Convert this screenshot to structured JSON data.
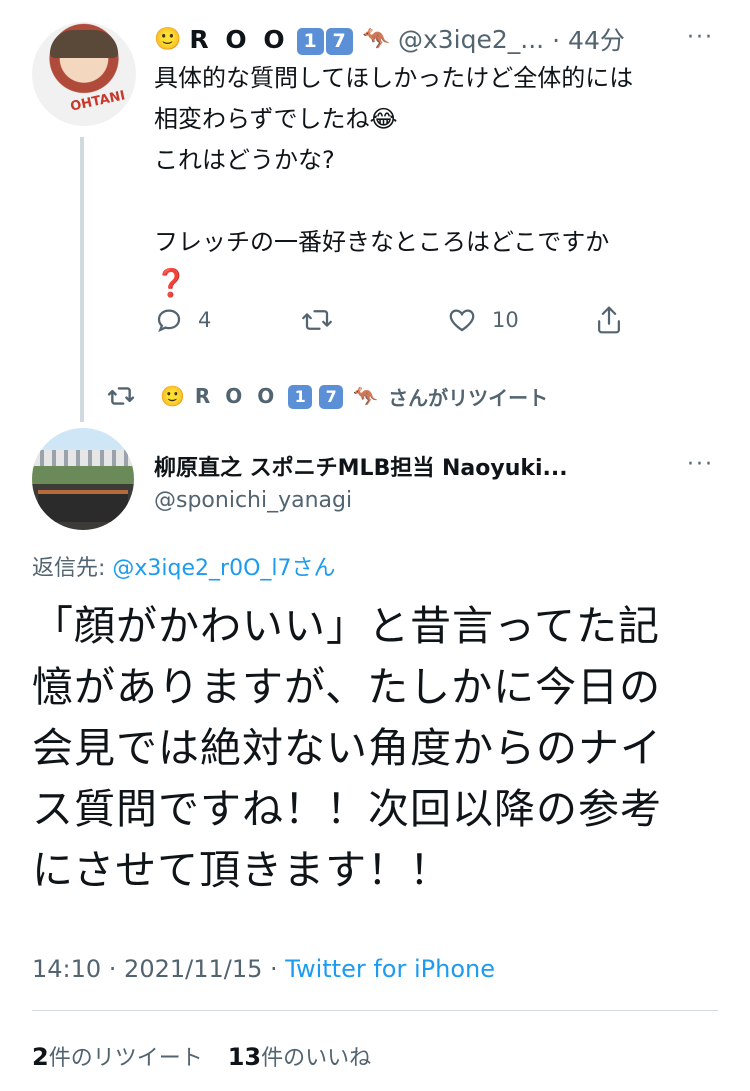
{
  "first_tweet": {
    "name": "R O O",
    "emoji_smile": "🙂",
    "badge1": "1",
    "badge2": "7",
    "emoji_kangaroo": "🦘",
    "handle": "@x3iqe2_...",
    "time": "· 44分",
    "more": "···",
    "avatar_text": "OHTANI",
    "text": "具体的な質問してほしかったけど全体的には\n相変わらずでしたね😂\nこれはどうかな?\n\nフレッチの一番好きなところはどこですか\n",
    "question_mark": "❓",
    "reply_count": "4",
    "retweet_count": "",
    "like_count": "10"
  },
  "retweet_notice": {
    "emoji_smile": "🙂",
    "name": "R O O",
    "badge1": "1",
    "badge2": "7",
    "emoji_kangaroo": "🦘",
    "suffix": "さんがリツイート"
  },
  "main_tweet": {
    "name": "柳原直之 スポニチMLB担当 Naoyuki...",
    "handle": "@sponichi_yanagi",
    "more": "···",
    "reply_prefix": "返信先: ",
    "reply_to": "@x3iqe2_r0O_l7さん",
    "text": "「顔がかわいい」と昔言ってた記\n憶がありますが、たしかに今日の\n会見では絶対ない角度からのナイ\nス質問ですね！！次回以降の参考\nにさせて頂きます！！",
    "time": "14:10 · 2021/11/15 · ",
    "client": "Twitter for iPhone",
    "retweets": "2",
    "retweets_label": "件のリツイート",
    "likes": "13",
    "likes_label": "件のいいね"
  },
  "colors": {
    "accent": "#1d9bf0",
    "muted": "#536471",
    "text": "#0f1419",
    "divider": "#cfd9de"
  }
}
